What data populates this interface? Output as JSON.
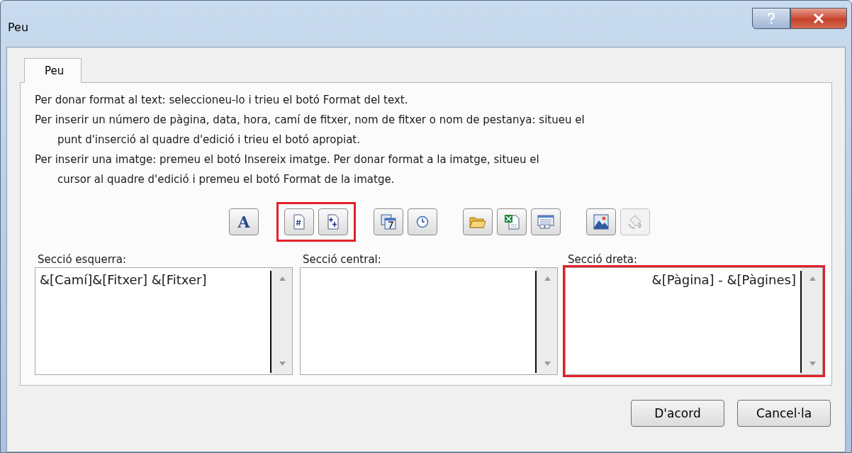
{
  "window": {
    "title": "Peu"
  },
  "tabs": [
    {
      "label": "Peu",
      "selected": true
    }
  ],
  "instructions": [
    "Per donar format al text: seleccioneu-lo i trieu el botó Format del text.",
    "Per inserir un número de pàgina, data, hora, camí de fitxer, nom de fitxer o nom de pestanya: situeu el",
    "punt d'inserció al quadre d'edició i trieu el botó apropiat.",
    "Per inserir una imatge: premeu el botó Insereix imatge. Per donar format a la imatge, situeu el",
    "cursor al quadre d'edició i premeu el botó Format de la imatge."
  ],
  "instruction_indent": [
    false,
    false,
    true,
    false,
    true
  ],
  "toolbar": [
    {
      "highlighted": false,
      "buttons": [
        {
          "kind": "font",
          "glyph": "A",
          "disabled": false
        }
      ]
    },
    {
      "highlighted": true,
      "buttons": [
        {
          "kind": "page-number",
          "disabled": false
        },
        {
          "kind": "page-count",
          "disabled": false
        }
      ]
    },
    {
      "highlighted": false,
      "buttons": [
        {
          "kind": "date",
          "disabled": false
        },
        {
          "kind": "time",
          "disabled": false
        }
      ]
    },
    {
      "highlighted": false,
      "buttons": [
        {
          "kind": "folder",
          "disabled": false
        },
        {
          "kind": "file",
          "disabled": false
        },
        {
          "kind": "sheet",
          "disabled": false
        }
      ]
    },
    {
      "highlighted": false,
      "buttons": [
        {
          "kind": "picture",
          "disabled": false
        },
        {
          "kind": "paint",
          "disabled": true
        }
      ]
    }
  ],
  "sections": [
    {
      "kind": "left",
      "label": "Secció esquerra:",
      "value": "&[Camí]&[Fitxer] &[Fitxer]",
      "highlighted": false
    },
    {
      "kind": "center",
      "label": "Secció central:",
      "highlighted": false
    },
    {
      "kind": "right",
      "label": "Secció dreta:",
      "value": "&[Pàgina] - &[Pàgines]",
      "highlighted": true
    }
  ],
  "buttons": [
    "D'acord",
    "Cancel·la"
  ]
}
